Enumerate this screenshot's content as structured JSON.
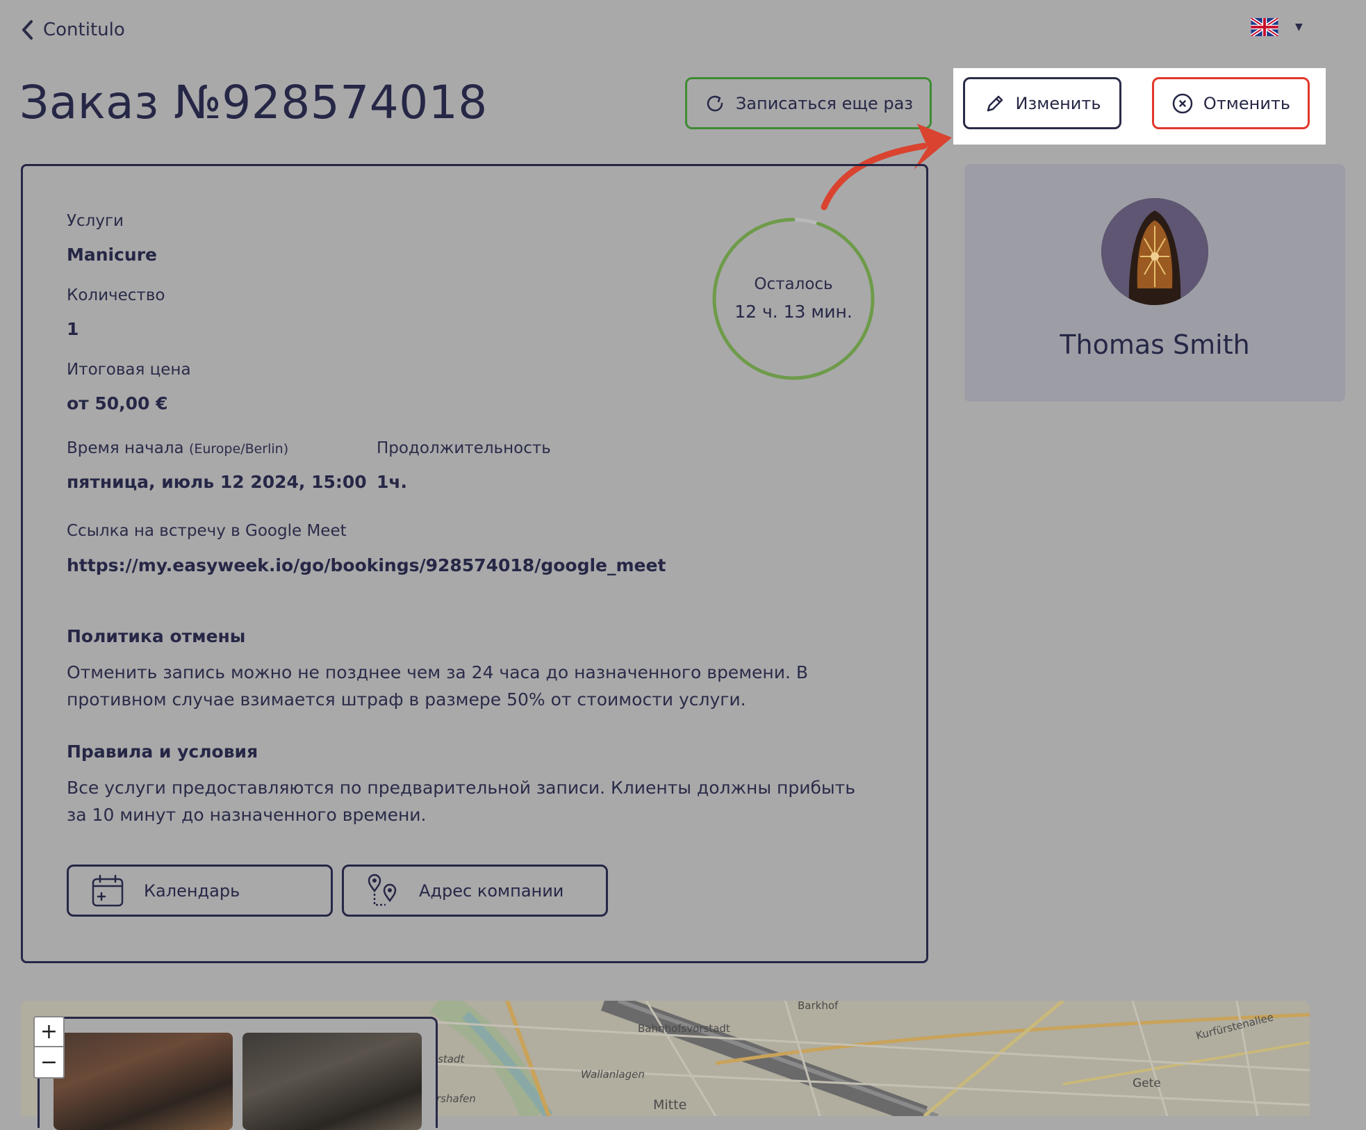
{
  "nav": {
    "back_label": "Contitulo"
  },
  "language": {
    "flag_icon": "uk-flag-icon"
  },
  "order": {
    "title": "Заказ №928574018"
  },
  "actions": {
    "rebook_label": "Записаться еще раз",
    "edit_label": "Изменить",
    "cancel_label": "Отменить"
  },
  "details": {
    "services_label": "Услуги",
    "services_value": "Manicure",
    "quantity_label": "Количество",
    "quantity_value": "1",
    "price_label": "Итоговая цена",
    "price_value": "от 50,00 €",
    "start_label": "Время начала",
    "start_timezone": "(Europe/Berlin)",
    "start_value": "пятница, июль 12 2024, 15:00",
    "duration_label": "Продолжительность",
    "duration_value": "1ч.",
    "meet_label": "Ссылка на встречу в Google Meet",
    "meet_link": "https://my.easyweek.io/go/bookings/928574018/google_meet"
  },
  "timer": {
    "label": "Осталось",
    "value": "12 ч. 13 мин.",
    "ring_fill_fraction": 0.95,
    "ring_color": "#6e9b4a"
  },
  "policy": {
    "title": "Политика отмены",
    "text": "Отменить запись можно не позднее чем за 24 часа до назначенного времени. В противном случае взимается штраф в размере 50% от стоимости услуги."
  },
  "terms": {
    "title": "Правила и условия",
    "text": "Все услуги предоставляются по предварительной записи. Клиенты должны прибыть за 10 минут до назначенного времени."
  },
  "bottom_buttons": {
    "calendar_label": "Календарь",
    "address_label": "Адрес компании"
  },
  "master": {
    "name": "Thomas Smith"
  },
  "map": {
    "zoom_in": "+",
    "zoom_out": "−",
    "labels": [
      "Barkhof",
      "Bahnhofsvorstadt",
      "Wallanlagen",
      "Mitte",
      "Gete",
      "Kurfürstenallee",
      "stadt",
      "rshafen"
    ]
  },
  "colors": {
    "accent_green": "#3f8b33",
    "cancel_red": "#e2372b",
    "primary_navy": "#262746",
    "arrow_red": "#d9432f"
  }
}
